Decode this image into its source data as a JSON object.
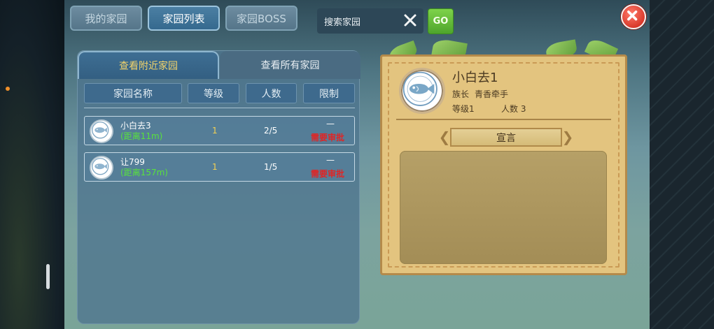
{
  "top_tabs": [
    {
      "label": "我的家园",
      "active": false
    },
    {
      "label": "家园列表",
      "active": true
    },
    {
      "label": "家园BOSS",
      "active": false
    }
  ],
  "search": {
    "value": "搜索家园",
    "go_label": "GO"
  },
  "icons": {
    "close": "close-icon",
    "clear": "clear-icon",
    "emblem": "fish-emblem-icon"
  },
  "list_panel": {
    "tabs": [
      {
        "label": "查看附近家园",
        "active": true
      },
      {
        "label": "查看所有家园",
        "active": false
      }
    ],
    "columns": [
      "家园名称",
      "等级",
      "人数",
      "限制"
    ],
    "rows": [
      {
        "name": "小白去3",
        "distance": "(距离11m)",
        "level": "1",
        "members": "2/5",
        "limit_dash": "—",
        "limit": "需要审批"
      },
      {
        "name": "让799",
        "distance": "(距离157m)",
        "level": "1",
        "members": "1/5",
        "limit_dash": "—",
        "limit": "需要审批"
      }
    ]
  },
  "detail": {
    "title": "小白去1",
    "leader_label": "族长",
    "leader_name": "青香牵手",
    "level_text": "等级1",
    "count_text": "人数 3",
    "declaration_label": "宣言",
    "declaration_text": ""
  },
  "colors": {
    "active_tab_text": "#f2d36a",
    "distance_text": "#58e23c",
    "limit_text": "#e02525",
    "go_button": "#5ab332",
    "close_button": "#d93a2c"
  }
}
